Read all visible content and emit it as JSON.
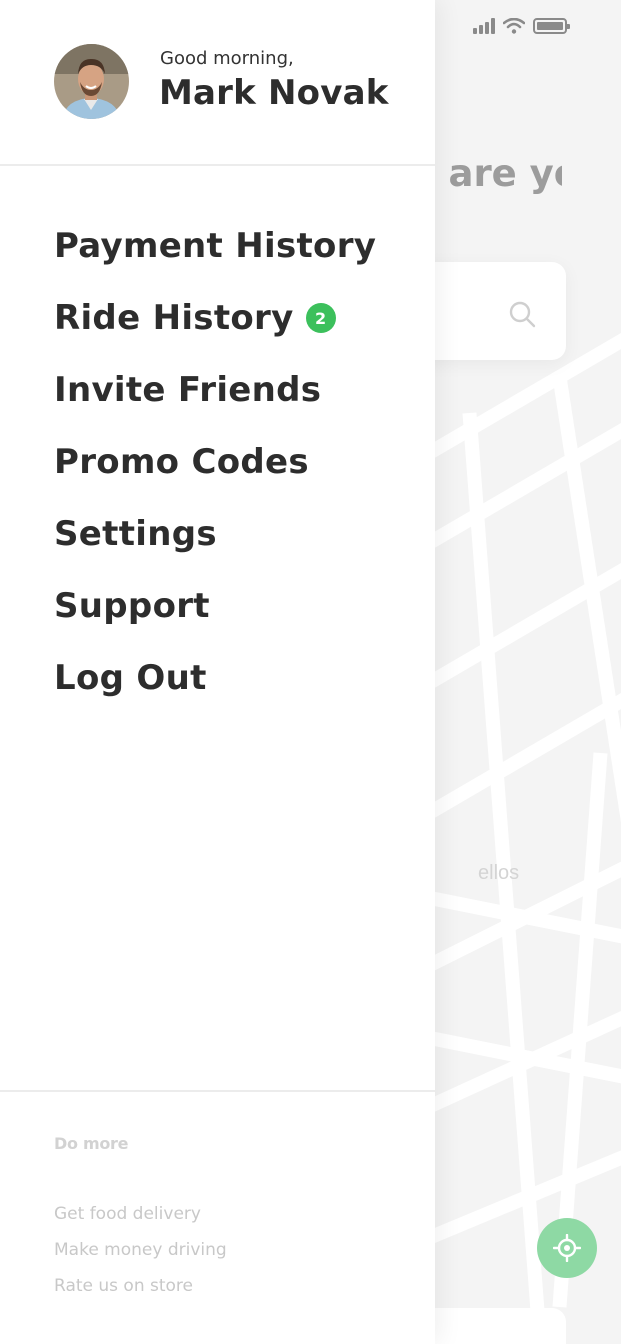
{
  "profile": {
    "greeting": "Good morning,",
    "name": "Mark Novak"
  },
  "menu": [
    {
      "label": "Payment History"
    },
    {
      "label": "Ride History",
      "badge": "2"
    },
    {
      "label": "Invite Friends"
    },
    {
      "label": "Promo Codes"
    },
    {
      "label": "Settings"
    },
    {
      "label": "Support"
    },
    {
      "label": "Log Out"
    }
  ],
  "footer": {
    "heading": "Do more",
    "links": [
      "Get food delivery",
      "Make money driving",
      "Rate us on store"
    ]
  },
  "background": {
    "question": "Where are you going?",
    "map_label": "ellos"
  },
  "icons": {
    "search": "search-icon",
    "locate": "crosshair-icon",
    "signal": "signal-icon",
    "wifi": "wifi-icon",
    "battery": "battery-icon"
  },
  "colors": {
    "badge": "#3cc05c",
    "locate_button": "#8ed9a4",
    "text_primary": "#2d2d2d",
    "text_muted": "#c8c8c8"
  }
}
